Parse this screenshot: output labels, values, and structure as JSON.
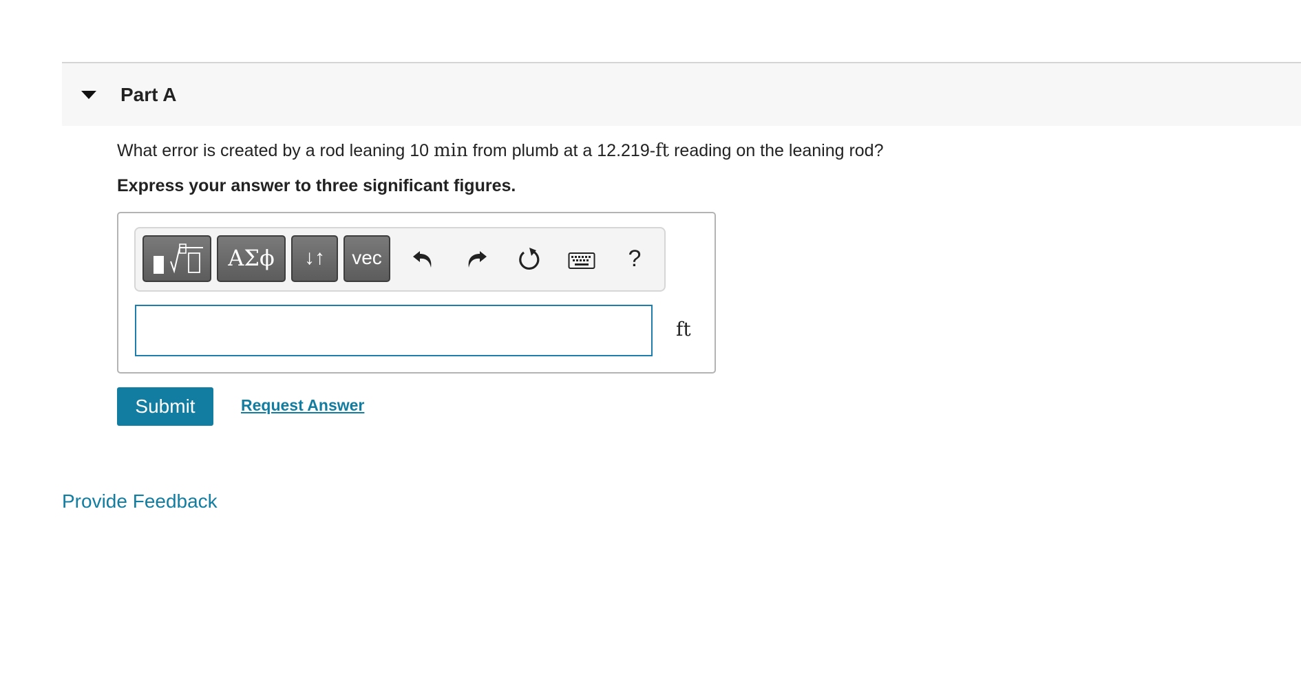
{
  "part": {
    "title": "Part A",
    "expanded": true
  },
  "question": {
    "text_before": "What error is created by a rod leaning 10 ",
    "math_1": "min",
    "text_middle": " from plumb at a 12.219-",
    "math_2": "ft",
    "text_after": " reading on the leaning rod?"
  },
  "instruction": "Express your answer to three significant figures.",
  "toolbar": {
    "greek_label": "ΑΣϕ",
    "arrows_label": "↓↑",
    "vec_label": "vec",
    "help_label": "?",
    "icons": [
      "templates-icon",
      "undo-icon",
      "redo-icon",
      "reset-icon",
      "keyboard-icon",
      "help-icon"
    ]
  },
  "answer": {
    "value": "",
    "unit": "ft",
    "border_color": "#1f7dad"
  },
  "actions": {
    "submit_label": "Submit",
    "request_answer_label": "Request Answer"
  },
  "footer": {
    "feedback_label": "Provide Feedback"
  },
  "colors": {
    "accent": "#127da0",
    "header_bg": "#f7f7f7",
    "tool_button": "#6b6b6b"
  }
}
